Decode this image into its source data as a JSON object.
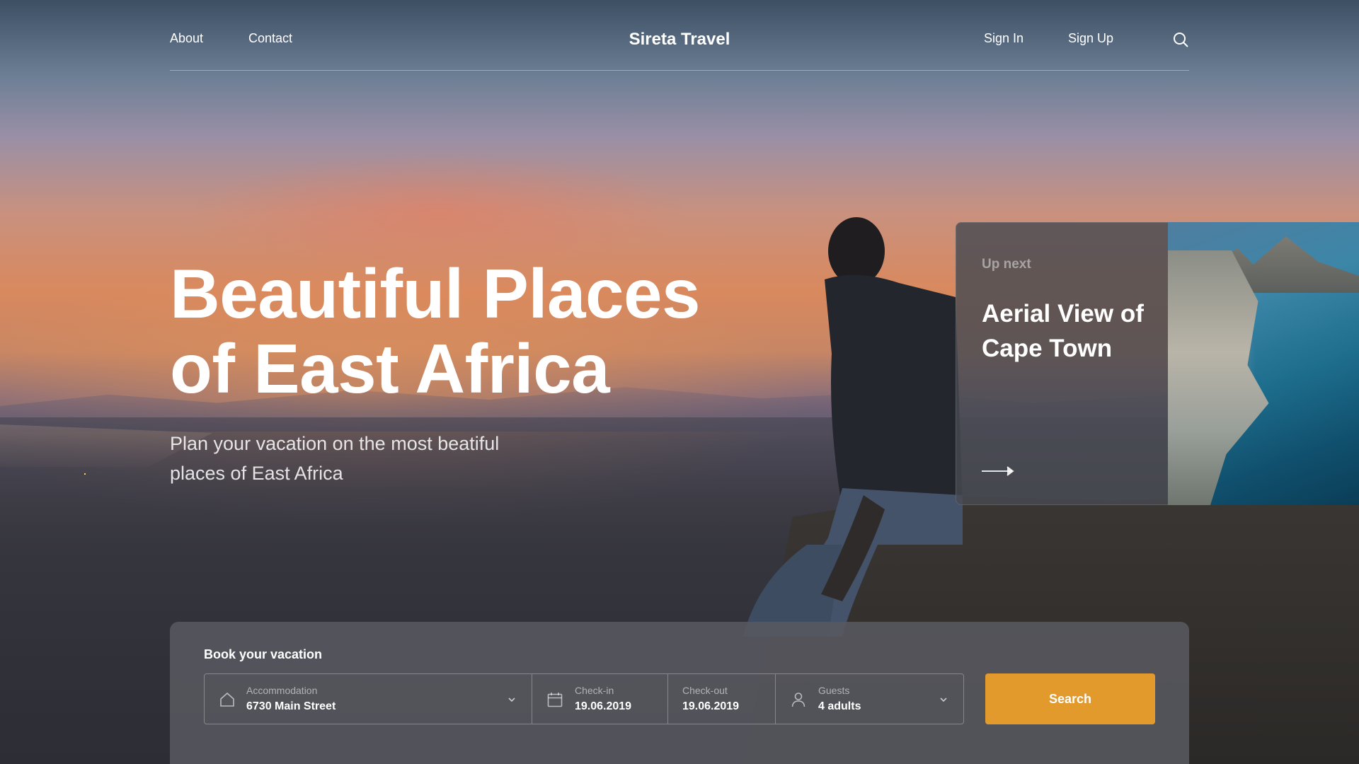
{
  "nav": {
    "left_links": [
      "About",
      "Contact"
    ],
    "brand": "Sireta Travel",
    "right_links": [
      "Sign In",
      "Sign Up"
    ],
    "search_icon": "search-icon"
  },
  "hero": {
    "title_line1": "Beautiful Places",
    "title_line2": "of East Africa",
    "subtitle": "Plan your vacation on the most beatiful places of East Africa"
  },
  "up_next": {
    "label": "Up next",
    "title": "Aerial View of Cape Town",
    "arrow_icon": "arrow-right-icon"
  },
  "booking": {
    "title": "Book your vacation",
    "accommodation": {
      "label": "Accommodation",
      "value": "6730 Main Street",
      "icon": "home-icon"
    },
    "check_in": {
      "label": "Check-in",
      "value": "19.06.2019",
      "icon": "calendar-icon"
    },
    "check_out": {
      "label": "Check-out",
      "value": "19.06.2019"
    },
    "guests": {
      "label": "Guests",
      "value": "4 adults",
      "icon": "user-icon"
    },
    "search_label": "Search"
  },
  "colors": {
    "accent": "#e39a2d",
    "panel": "#585960"
  }
}
